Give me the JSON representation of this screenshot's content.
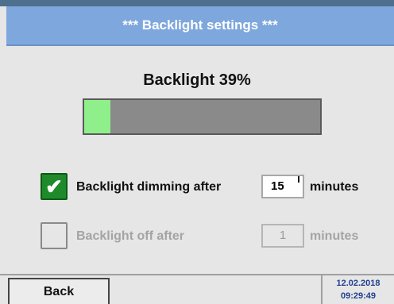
{
  "window": {
    "title": "***  Backlight settings  ***"
  },
  "backlight": {
    "label": "Backlight 39%",
    "level_percent": 39
  },
  "dimming": {
    "checked": true,
    "label": "Backlight dimming after",
    "value": "15",
    "unit": "minutes"
  },
  "off": {
    "checked": false,
    "label": "Backlight off after",
    "value": "1",
    "unit": "minutes"
  },
  "footer": {
    "back_label": "Back",
    "date": "12.02.2018",
    "time": "09:29:49"
  },
  "colors": {
    "title_bar": "#7ea7dd",
    "bar_fill": "#8fef8a",
    "check_on": "#1f8a2a",
    "datetime": "#1f3f8f"
  },
  "icons": {
    "dimming_check": "checkmark-icon"
  }
}
